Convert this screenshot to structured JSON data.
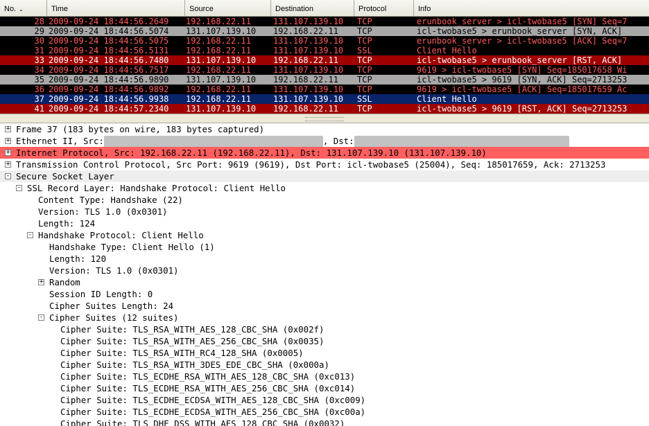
{
  "packet_list": {
    "columns": [
      {
        "label": "No.",
        "sort": "⌄"
      },
      {
        "label": "Time"
      },
      {
        "label": "Source"
      },
      {
        "label": "Destination"
      },
      {
        "label": "Protocol"
      },
      {
        "label": "Info"
      }
    ],
    "rows": [
      {
        "no": "28",
        "time": "2009-09-24 18:44:56.2649",
        "src": "192.168.22.11",
        "dst": "131.107.139.10",
        "proto": "TCP",
        "info": "erunbook_server > icl-twobase5 [SYN] Seq=7",
        "bg": "#000000",
        "fg": "#ff5a5a"
      },
      {
        "no": "29",
        "time": "2009-09-24 18:44:56.5074",
        "src": "131.107.139.10",
        "dst": "192.168.22.11",
        "proto": "TCP",
        "info": "icl-twobase5 > erunbook_server [SYN, ACK]",
        "bg": "#a8a8a8",
        "fg": "#000000"
      },
      {
        "no": "30",
        "time": "2009-09-24 18:44:56.5075",
        "src": "192.168.22.11",
        "dst": "131.107.139.10",
        "proto": "TCP",
        "info": "erunbook_server > icl-twobase5 [ACK] Seq=7",
        "bg": "#000000",
        "fg": "#ff5a5a"
      },
      {
        "no": "31",
        "time": "2009-09-24 18:44:56.5131",
        "src": "192.168.22.11",
        "dst": "131.107.139.10",
        "proto": "SSL",
        "info": "Client Hello",
        "bg": "#000000",
        "fg": "#ff5a5a"
      },
      {
        "no": "33",
        "time": "2009-09-24 18:44:56.7480",
        "src": "131.107.139.10",
        "dst": "192.168.22.11",
        "proto": "TCP",
        "info": "icl-twobase5 > erunbook_server [RST, ACK]",
        "bg": "#a00000",
        "fg": "#ffffff"
      },
      {
        "no": "34",
        "time": "2009-09-24 18:44:56.7517",
        "src": "192.168.22.11",
        "dst": "131.107.139.10",
        "proto": "TCP",
        "info": "9619 > icl-twobase5 [SYN] Seq=185017658 Wi",
        "bg": "#000000",
        "fg": "#ff5a5a"
      },
      {
        "no": "35",
        "time": "2009-09-24 18:44:56.9890",
        "src": "131.107.139.10",
        "dst": "192.168.22.11",
        "proto": "TCP",
        "info": "icl-twobase5 > 9619 [SYN, ACK] Seq=2713253",
        "bg": "#a8a8a8",
        "fg": "#000000"
      },
      {
        "no": "36",
        "time": "2009-09-24 18:44:56.9892",
        "src": "192.168.22.11",
        "dst": "131.107.139.10",
        "proto": "TCP",
        "info": "9619 > icl-twobase5 [ACK] Seq=185017659 Ac",
        "bg": "#000000",
        "fg": "#ff5a5a"
      },
      {
        "no": "37",
        "time": "2009-09-24 18:44:56.9938",
        "src": "192.168.22.11",
        "dst": "131.107.139.10",
        "proto": "SSL",
        "info": "Client Hello",
        "bg": "#0a246a",
        "fg": "#ffffff"
      },
      {
        "no": "41",
        "time": "2009-09-24 18:44:57.2340",
        "src": "131.107.139.10",
        "dst": "192.168.22.11",
        "proto": "TCP",
        "info": "icl-twobase5 > 9619 [RST, ACK] Seq=2713253",
        "bg": "#a00000",
        "fg": "#ffffff"
      }
    ]
  },
  "details": {
    "rows": [
      {
        "depth": 0,
        "expander": "+",
        "text": "Frame 37 (183 bytes on wire, 183 bytes captured)",
        "style": "normal"
      },
      {
        "depth": 0,
        "expander": "+",
        "text": "Ethernet II, Src:",
        "text2": ", Dst:",
        "redacted": true,
        "style": "normal"
      },
      {
        "depth": 0,
        "expander": "+",
        "text": "Internet Protocol, Src: 192.168.22.11 (192.168.22.11), Dst: 131.107.139.10 (131.107.139.10)",
        "style": "error"
      },
      {
        "depth": 0,
        "expander": "+",
        "text": "Transmission Control Protocol, Src Port: 9619 (9619), Dst Port: icl-twobase5 (25004), Seq: 185017659, Ack: 2713253",
        "style": "normal"
      },
      {
        "depth": 0,
        "expander": "-",
        "text": "Secure Socket Layer",
        "style": "gray"
      },
      {
        "depth": 1,
        "expander": "-",
        "text": "SSL Record Layer: Handshake Protocol: Client Hello",
        "style": "normal"
      },
      {
        "depth": 2,
        "expander": "",
        "text": "Content Type: Handshake (22)",
        "style": "normal"
      },
      {
        "depth": 2,
        "expander": "",
        "text": "Version: TLS 1.0 (0x0301)",
        "style": "normal"
      },
      {
        "depth": 2,
        "expander": "",
        "text": "Length: 124",
        "style": "normal"
      },
      {
        "depth": 2,
        "expander": "-",
        "text": "Handshake Protocol: Client Hello",
        "style": "normal"
      },
      {
        "depth": 3,
        "expander": "",
        "text": "Handshake Type: Client Hello (1)",
        "style": "normal"
      },
      {
        "depth": 3,
        "expander": "",
        "text": "Length: 120",
        "style": "normal"
      },
      {
        "depth": 3,
        "expander": "",
        "text": "Version: TLS 1.0 (0x0301)",
        "style": "normal"
      },
      {
        "depth": 3,
        "expander": "+",
        "text": "Random",
        "style": "normal"
      },
      {
        "depth": 3,
        "expander": "",
        "text": "Session ID Length: 0",
        "style": "normal"
      },
      {
        "depth": 3,
        "expander": "",
        "text": "Cipher Suites Length: 24",
        "style": "normal"
      },
      {
        "depth": 3,
        "expander": "-",
        "text": "Cipher Suites (12 suites)",
        "style": "normal"
      },
      {
        "depth": 4,
        "expander": "",
        "text": "Cipher Suite: TLS_RSA_WITH_AES_128_CBC_SHA (0x002f)",
        "style": "normal"
      },
      {
        "depth": 4,
        "expander": "",
        "text": "Cipher Suite: TLS_RSA_WITH_AES_256_CBC_SHA (0x0035)",
        "style": "normal"
      },
      {
        "depth": 4,
        "expander": "",
        "text": "Cipher Suite: TLS_RSA_WITH_RC4_128_SHA (0x0005)",
        "style": "normal"
      },
      {
        "depth": 4,
        "expander": "",
        "text": "Cipher Suite: TLS_RSA_WITH_3DES_EDE_CBC_SHA (0x000a)",
        "style": "normal"
      },
      {
        "depth": 4,
        "expander": "",
        "text": "Cipher Suite: TLS_ECDHE_RSA_WITH_AES_128_CBC_SHA (0xc013)",
        "style": "normal"
      },
      {
        "depth": 4,
        "expander": "",
        "text": "Cipher Suite: TLS_ECDHE_RSA_WITH_AES_256_CBC_SHA (0xc014)",
        "style": "normal"
      },
      {
        "depth": 4,
        "expander": "",
        "text": "Cipher Suite: TLS_ECDHE_ECDSA_WITH_AES_128_CBC_SHA (0xc009)",
        "style": "normal"
      },
      {
        "depth": 4,
        "expander": "",
        "text": "Cipher Suite: TLS_ECDHE_ECDSA_WITH_AES_256_CBC_SHA (0xc00a)",
        "style": "normal"
      },
      {
        "depth": 4,
        "expander": "",
        "text": "Cipher Suite: TLS_DHE_DSS_WITH_AES_128_CBC_SHA (0x0032)",
        "style": "normal"
      }
    ]
  }
}
